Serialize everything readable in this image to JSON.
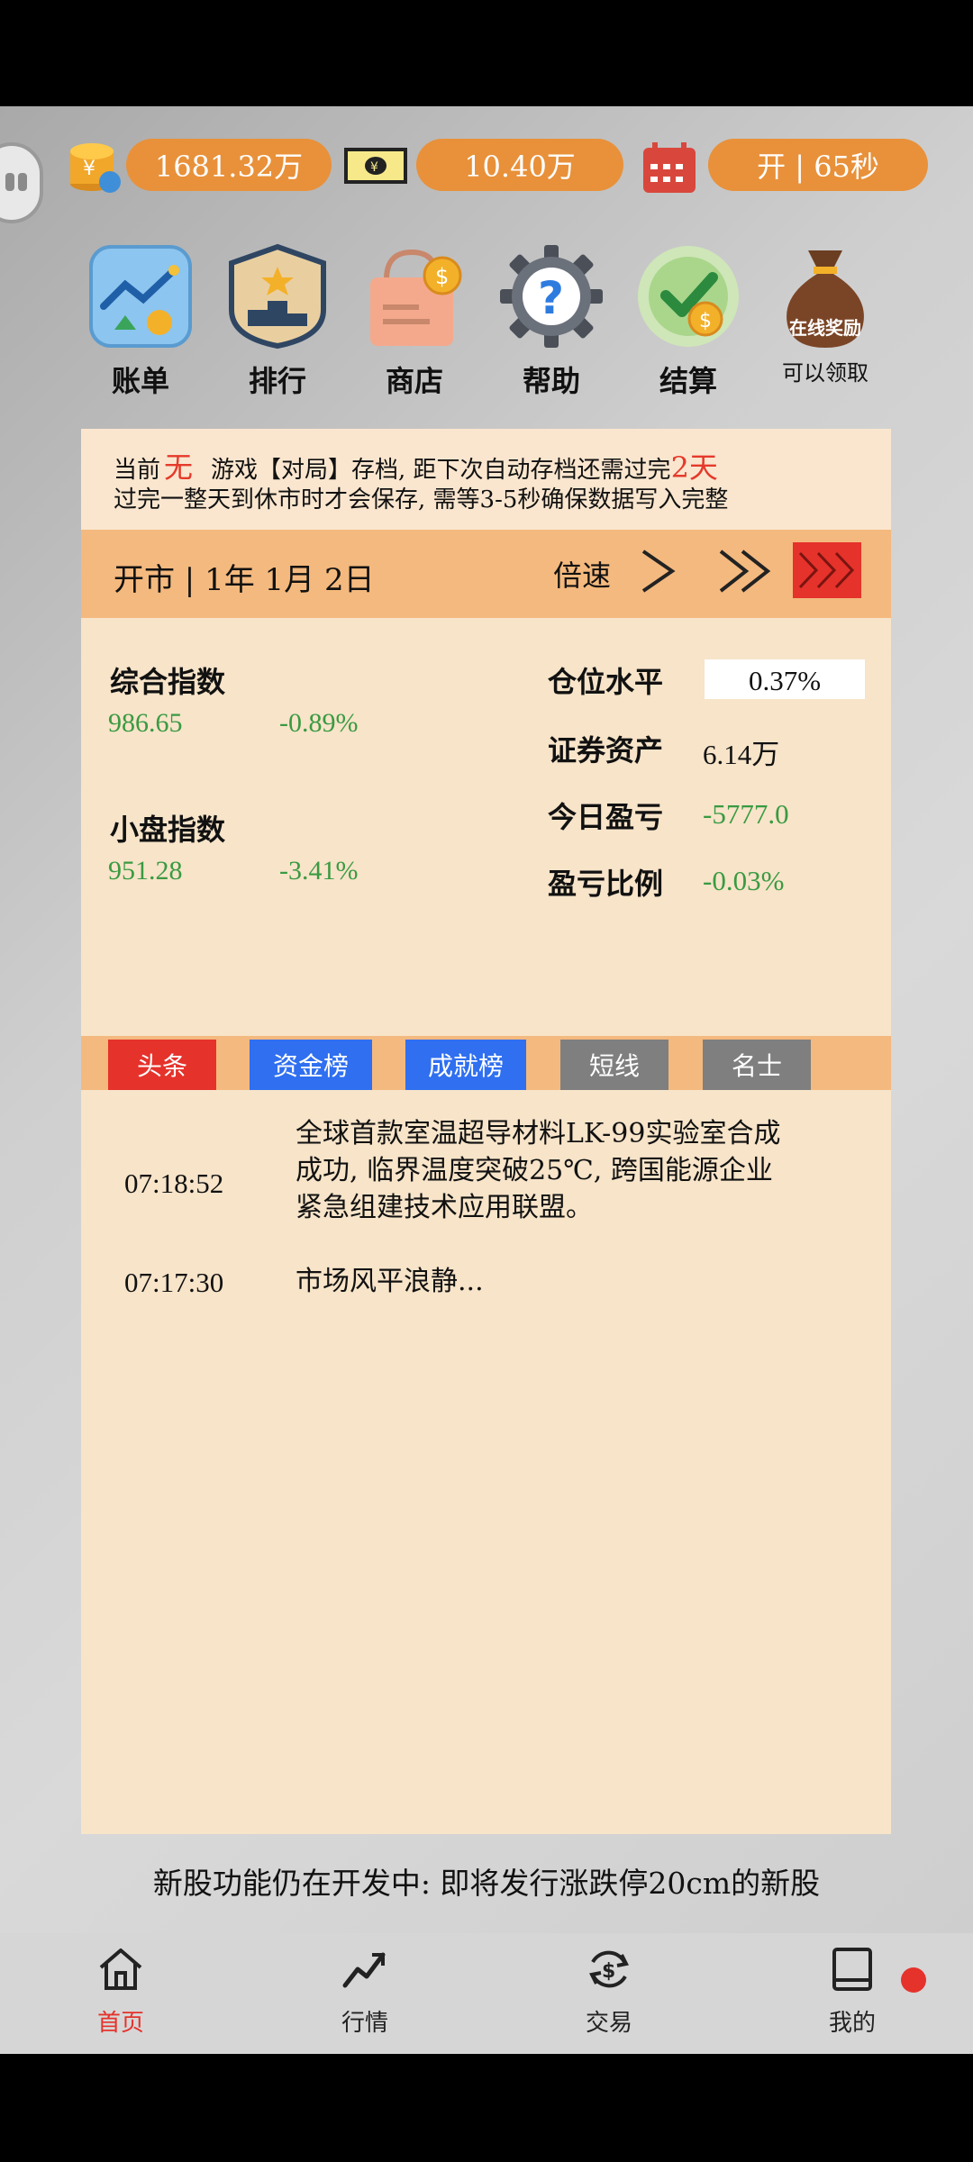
{
  "top_bar": {
    "coins": "1681.32万",
    "cash": "10.40万",
    "market": "开 | 65秒"
  },
  "menu": [
    {
      "label": "账单",
      "icon": "chart-up-icon"
    },
    {
      "label": "排行",
      "icon": "podium-icon"
    },
    {
      "label": "商店",
      "icon": "shopping-bag-icon"
    },
    {
      "label": "帮助",
      "icon": "help-gear-icon"
    },
    {
      "label": "结算",
      "icon": "checkmark-coin-icon"
    },
    {
      "label": "可以领取",
      "icon": "money-bag-icon",
      "badge": "在线奖励"
    }
  ],
  "notice": {
    "prefix": "当前",
    "save_state": "无",
    "middle": "游戏【对局】存档, 距下次自动存档还需过完",
    "days": "2天",
    "line2": "过完一整天到休市时才会保存, 需等3-5秒确保数据写入完整"
  },
  "date_bar": {
    "date": "开市 | 1年 1月 2日",
    "speed_label": "倍速"
  },
  "indices": {
    "composite": {
      "name": "综合指数",
      "value": "986.65",
      "change": "-0.89%"
    },
    "small_cap": {
      "name": "小盘指数",
      "value": "951.28",
      "change": "-3.41%"
    }
  },
  "account": {
    "position_label": "仓位水平",
    "position_value": "0.37%",
    "assets_label": "证券资产",
    "assets_value": "6.14万",
    "pnl_label": "今日盈亏",
    "pnl_value": "-5777.0",
    "ratio_label": "盈亏比例",
    "ratio_value": "-0.03%"
  },
  "tabs": [
    {
      "label": "头条",
      "color": "#e5322b"
    },
    {
      "label": "资金榜",
      "color": "#2f6ff0"
    },
    {
      "label": "成就榜",
      "color": "#2f6ff0"
    },
    {
      "label": "短线",
      "color": "#7f7f7f"
    },
    {
      "label": "名士",
      "color": "#7f7f7f"
    }
  ],
  "news": [
    {
      "time": "07:18:52",
      "line1": "全球首款室温超导材料LK-99实验室合成",
      "line2": "成功, 临界温度突破25℃, 跨国能源企业",
      "line3": "紧急组建技术应用联盟。"
    },
    {
      "time": "07:17:30",
      "line1": "市场风平浪静..."
    }
  ],
  "ticker": "新股功能仍在开发中: 即将发行涨跌停20cm的新股",
  "nav": [
    {
      "label": "首页",
      "icon": "home-icon",
      "active": true
    },
    {
      "label": "行情",
      "icon": "trend-icon"
    },
    {
      "label": "交易",
      "icon": "exchange-dollar-icon"
    },
    {
      "label": "我的",
      "icon": "book-icon"
    }
  ],
  "colors": {
    "accent": "#e8913a",
    "up": "#3a9a42",
    "alert": "#e53a2a",
    "active_nav": "#e5322b"
  }
}
